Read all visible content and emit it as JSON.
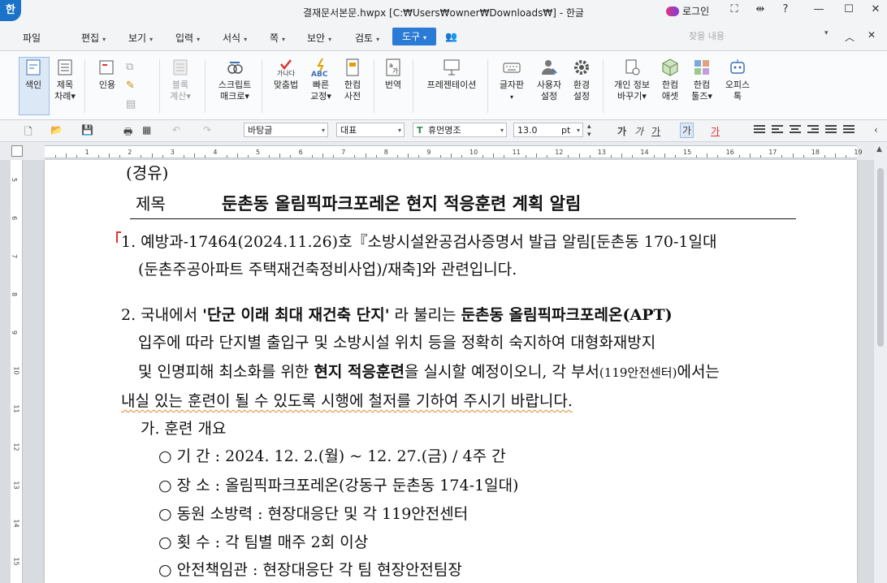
{
  "window": {
    "app_logo": "한",
    "title": "결재문서본문.hwpx [C:₩Users₩owner₩Downloads₩] - 한글",
    "login": "로그인",
    "controls": [
      "⛶",
      "⇹",
      "?",
      "—",
      "☐",
      "✕"
    ]
  },
  "menu": {
    "items": [
      "파일",
      "편집",
      "보기",
      "입력",
      "서식",
      "쪽",
      "보안",
      "검토"
    ],
    "active": "도구",
    "search_placeholder": "찾을 내용"
  },
  "ribbon": {
    "buttons": [
      {
        "line1": "색인",
        "line2": ""
      },
      {
        "line1": "제목",
        "line2": "차례▾"
      },
      {
        "line1": "인용",
        "line2": ""
      },
      {
        "line1": "블록",
        "line2": "계산▾"
      },
      {
        "line1": "스크립트",
        "line2": "매크로▾"
      },
      {
        "line1": "맞춤법",
        "line2": ""
      },
      {
        "line1": "빠른",
        "line2": "교정▾"
      },
      {
        "line1": "한컴",
        "line2": "사전"
      },
      {
        "line1": "번역",
        "line2": ""
      },
      {
        "line1": "프레젠테이션",
        "line2": ""
      },
      {
        "line1": "글자판",
        "line2": ""
      },
      {
        "line1": "사용자",
        "line2": "설정"
      },
      {
        "line1": "환경",
        "line2": "설정"
      },
      {
        "line1": "개인 정보",
        "line2": "바꾸기▾"
      },
      {
        "line1": "한컴",
        "line2": "애셋"
      },
      {
        "line1": "한컴",
        "line2": "툴즈▾"
      },
      {
        "line1": "오피스",
        "line2": "톡"
      }
    ]
  },
  "format": {
    "style": "바탕글",
    "language": "대표",
    "font": "휴먼명조",
    "size": "13.0",
    "unit": "pt"
  },
  "ruler": {
    "numbers": [
      "1",
      "2",
      "3",
      "4",
      "5",
      "6",
      "7",
      "8",
      "9",
      "10",
      "11",
      "12",
      "13",
      "14",
      "15",
      "16",
      "17",
      "18",
      "19"
    ],
    "vnumbers": [
      "5",
      "6",
      "7",
      "8",
      "9",
      "10",
      "11",
      "12",
      "13",
      "14",
      "15"
    ]
  },
  "document": {
    "via": "(경유)",
    "subject_label": "제목",
    "subject": "둔촌동 올림픽파크포레온 현지 적응훈련 계획 알림",
    "p1_line1": "1. 예방과-17464(2024.11.26)호『소방시설완공검사증명서 발급 알림[둔촌동 170-1일대",
    "p1_line2": "(둔촌주공아파트 주택재건축정비사업)/재축]와 관련입니다.",
    "p2_a": "2. 국내에서 ",
    "p2_b": "'단군 이래 최대 재건축 단지'",
    "p2_c": " 라 불리는 ",
    "p2_d": "둔촌동 올림픽파크포레온(APT)",
    "p2_line2": "입주에 따라 단지별 출입구 및 소방시설 위치 등을 정확히 숙지하여 대형화재방지",
    "p2_line3_a": "및 인명피해 최소화를 위한 ",
    "p2_line3_b": "현지 적응훈련",
    "p2_line3_c": "을 실시할 예정이오니, 각 부서",
    "p2_line3_d": "(119안전센터)",
    "p2_line3_e": "에서는",
    "p2_line4": "내실 있는 훈련이 될 수 있도록 시행에 철저를 기하여 주시기 바랍니다.",
    "sub_a": "가. 훈련 개요",
    "items": [
      "○ 기  간 : 2024. 12. 2.(월) ~ 12. 27.(금) / 4주 간",
      "○ 장  소 : 올림픽파크포레온(강동구 둔촌동 174-1일대)",
      "○ 동원 소방력 : 현장대응단 및 각 119안전센터",
      "○ 횟  수 : 각 팀별 매주 2회 이상",
      "○ 안전책임관 : 현장대응단 각 팀 현장안전팀장"
    ]
  }
}
